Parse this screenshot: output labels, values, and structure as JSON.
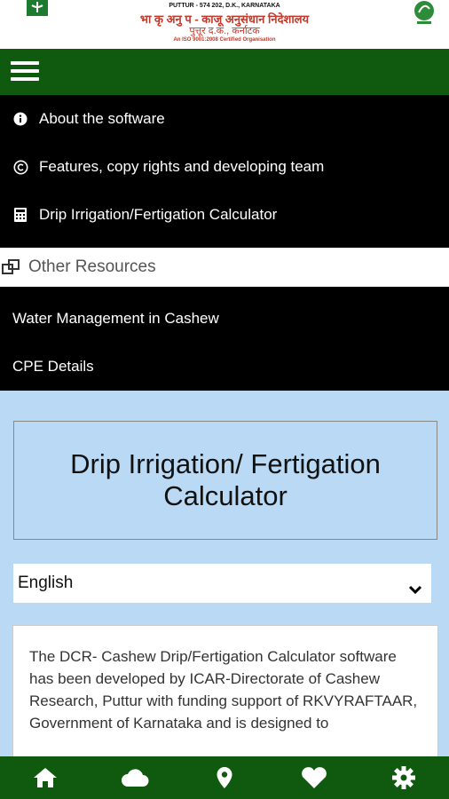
{
  "header": {
    "line1": "PUTTUR - 574 202, D.K., KARNATAKA",
    "line2": "भा कृ अनु प - काजू अनुसंधान निदेशालय",
    "line3": "पुत्तूर द.क., कर्नाटक",
    "line4": "An ISO 9001:2008 Certified Organisation"
  },
  "menu": {
    "items": [
      {
        "label": "About the software",
        "icon": "info-icon"
      },
      {
        "label": "Features, copy rights and developing team",
        "icon": "copyright-icon"
      },
      {
        "label": "Drip Irrigation/Fertigation Calculator",
        "icon": "calculator-icon"
      }
    ],
    "other_resources": "Other Resources",
    "resources": [
      {
        "label": "Water Management in Cashew"
      },
      {
        "label": "CPE Details"
      }
    ]
  },
  "main": {
    "title": "Drip Irrigation/ Fertigation Calculator",
    "language": "English",
    "description": "The DCR- Cashew Drip/Fertigation Calculator software has been developed by ICAR-Directorate of Cashew Research, Puttur with funding support of RKVYRAFTAAR, Government of Karnataka and is designed to"
  },
  "bottom_nav": [
    "home-icon",
    "cloud-icon",
    "location-icon",
    "heart-icon",
    "settings-icon"
  ],
  "colors": {
    "bar_green": "#0f5a0f",
    "menu_black": "#000000",
    "main_bg": "#b9d9f5",
    "hindi_red": "#c0392b"
  }
}
